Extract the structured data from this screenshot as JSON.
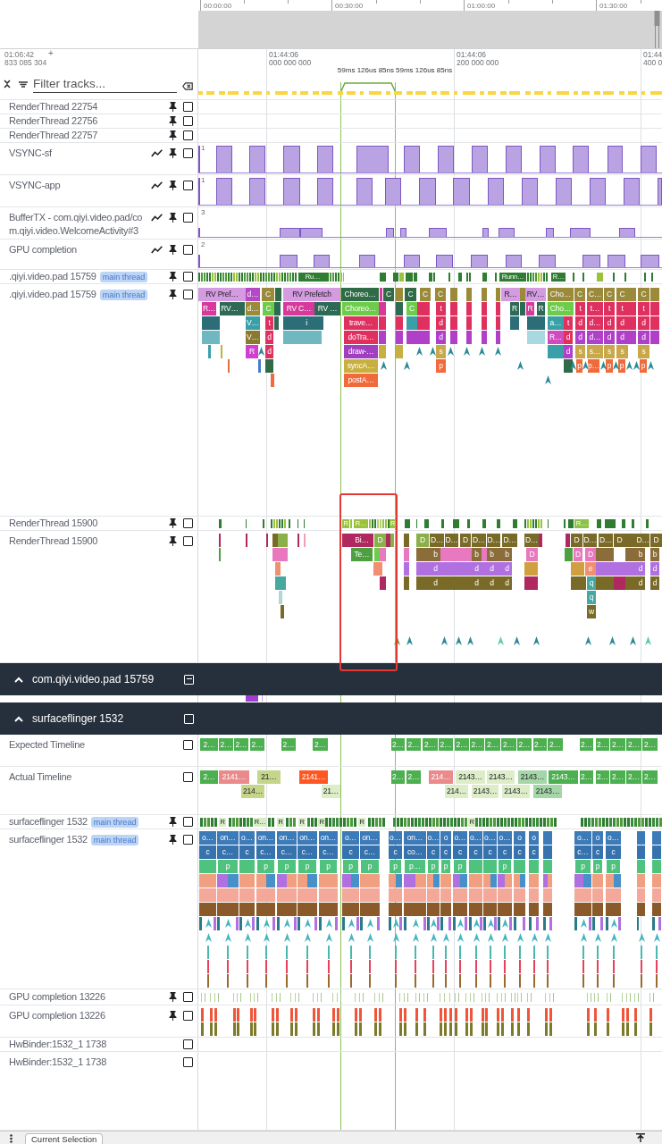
{
  "overview": {
    "ticks": [
      "00:00:00",
      "00:30:00",
      "01:00:00",
      "01:30:00"
    ]
  },
  "ruler": {
    "offset_time": "01:06:42",
    "offset_button": "+",
    "offset_ns": "833 085 304",
    "ticks": [
      {
        "time": "01:44:06",
        "ns": "000 000 000"
      },
      {
        "time": "01:44:06",
        "ns": "200 000 000"
      },
      {
        "time": "01:44",
        "ns": "400 0"
      }
    ],
    "selection_labels": [
      "59ms 126us 85ns",
      "59ms 126us 85ns"
    ]
  },
  "filter": {
    "placeholder": "Filter tracks..."
  },
  "tracks": [
    {
      "kind": "slice",
      "label": "RenderThread 22754",
      "pin_button": true,
      "checked": false
    },
    {
      "kind": "slice",
      "label": "RenderThread 22756",
      "pin_button": true,
      "checked": false
    },
    {
      "kind": "slice",
      "label": "RenderThread 22757",
      "pin_button": true,
      "checked": false
    },
    {
      "kind": "counter",
      "label": "VSYNC-sf",
      "max_label": "1",
      "chart_button": true,
      "pin_button": true,
      "checked": false
    },
    {
      "kind": "counter",
      "label": "VSYNC-app",
      "max_label": "1",
      "chart_button": true,
      "pin_button": true,
      "checked": false
    },
    {
      "kind": "counter",
      "label": "BufferTX - com.qiyi.video.pad/com.qiyi.video.WelcomeActivity#3",
      "max_label": "3",
      "chart_button": true,
      "pin_button": true,
      "checked": false
    },
    {
      "kind": "counter",
      "label": "GPU completion",
      "max_label": "2",
      "chart_button": true,
      "pin_button": true,
      "checked": false
    },
    {
      "kind": "state",
      "label": ".qiyi.video.pad 15759",
      "tag": "main thread",
      "pin_button": true,
      "checked": false,
      "slices": [
        {
          "label": "Ru…",
          "color": "#2f7d32"
        },
        {
          "label": "Runn…",
          "color": "#2f7d32"
        },
        {
          "label": "R…",
          "color": "#2f7d32"
        }
      ]
    },
    {
      "kind": "slice",
      "label": ".qiyi.video.pad 15759",
      "tag": "main thread",
      "pin_button": true,
      "checked": false,
      "slices": [
        {
          "label": "RV Pref…",
          "color": "#d49be0",
          "children": [
            {
              "label": "R…",
              "color": "#d6399b"
            },
            {
              "label": "RV…",
              "color": "#2d6a56"
            }
          ]
        },
        {
          "label": "d…",
          "color": "#b548c6",
          "children": [
            {
              "label": "d…",
              "color": "#9a8a3a",
              "children": [
                {
                  "label": "V…",
                  "color": "#3aa0a8",
                  "children": [
                    {
                      "label": "V…",
                      "color": "#8a7a30",
                      "children": [
                        {
                          "label": "R",
                          "color": "#d040d0"
                        }
                      ]
                    }
                  ]
                }
              ]
            }
          ]
        },
        {
          "label": "C",
          "color": "#9a8a3a",
          "children": [
            {
              "label": "C",
              "color": "#6dcc4a",
              "children": [
                {
                  "label": "t",
                  "color": "#e0305f",
                  "children": [
                    {
                      "label": "d",
                      "color": "#e0305f",
                      "children": [
                        {
                          "label": "d",
                          "color": "#e0305f"
                        }
                      ]
                    }
                  ]
                }
              ]
            }
          ]
        },
        {
          "label": "RV Prefetch",
          "color": "#d49be0",
          "children": [
            {
              "label": "RV C…",
              "color": "#d6399b",
              "children": [
                {
                  "label": "i",
                  "color": "#2c6e78"
                }
              ]
            },
            {
              "label": "RV …",
              "color": "#2d6a56"
            }
          ]
        },
        {
          "label": "Choreo…",
          "color": "#2e6b46",
          "children": [
            {
              "label": "Choreo…",
              "color": "#6dcc4a",
              "children": [
                {
                  "label": "trave…",
                  "color": "#e0305f",
                  "children": [
                    {
                      "label": "doTra…",
                      "color": "#e0305f",
                      "children": [
                        {
                          "label": "draw-…",
                          "color": "#a040c0",
                          "children": [
                            {
                              "label": "syncA…",
                              "color": "#c8b040",
                              "children": [
                                {
                                  "label": "postA…",
                                  "color": "#f06a3c"
                                }
                              ]
                            }
                          ]
                        }
                      ]
                    }
                  ]
                }
              ]
            }
          ]
        },
        {
          "label": "C",
          "color": "#2e6b46"
        },
        {
          "label": "C",
          "color": "#2e6b46",
          "children": [
            {
              "label": "C",
              "color": "#6dcc4a"
            }
          ]
        },
        {
          "label": "C",
          "color": "#9a8a3a"
        },
        {
          "label": "C",
          "color": "#9a8a3a",
          "children": [
            {
              "label": "t",
              "color": "#e0305f",
              "children": [
                {
                  "label": "d",
                  "color": "#e0305f",
                  "children": [
                    {
                      "label": "d",
                      "color": "#b040c8",
                      "children": [
                        {
                          "label": "s",
                          "color": "#c8a84a",
                          "children": [
                            {
                              "label": "p",
                              "color": "#f06a3c"
                            }
                          ]
                        }
                      ]
                    }
                  ]
                }
              ]
            }
          ]
        },
        {
          "label": "R…",
          "color": "#d49be0",
          "children": [
            {
              "label": "R",
              "color": "#2d6a56"
            }
          ]
        },
        {
          "label": "RV…",
          "color": "#d49be0",
          "children": [
            {
              "label": "R",
              "color": "#d6399b"
            },
            {
              "label": "R",
              "color": "#2d6a56"
            }
          ]
        },
        {
          "label": "Cho…",
          "color": "#9a8a3a",
          "children": [
            {
              "label": "Cho…",
              "color": "#6dcc4a",
              "children": [
                {
                  "label": "a…",
                  "color": "#3aa0a8",
                  "children": [
                    {
                      "label": "R…",
                      "color": "#d04ac0"
                    }
                  ]
                },
                {
                  "label": "t",
                  "color": "#e0305f",
                  "children": [
                    {
                      "label": "d",
                      "color": "#e0305f",
                      "children": [
                        {
                          "label": "d",
                          "color": "#b040c8"
                        }
                      ]
                    }
                  ]
                }
              ]
            }
          ]
        },
        {
          "label": "C",
          "color": "#9a8a3a",
          "children": [
            {
              "label": "t",
              "color": "#e0305f",
              "children": [
                {
                  "label": "d",
                  "color": "#e0305f",
                  "children": [
                    {
                      "label": "d",
                      "color": "#b040c8",
                      "children": [
                        {
                          "label": "s",
                          "color": "#c8a84a",
                          "children": [
                            {
                              "label": "p",
                              "color": "#f06a3c"
                            }
                          ]
                        }
                      ]
                    }
                  ]
                }
              ]
            }
          ]
        },
        {
          "label": "C…",
          "color": "#9a8a3a",
          "children": [
            {
              "label": "t…",
              "color": "#e0305f",
              "children": [
                {
                  "label": "d…",
                  "color": "#e0305f",
                  "children": [
                    {
                      "label": "d…",
                      "color": "#b040c8",
                      "children": [
                        {
                          "label": "s…",
                          "color": "#c8a84a",
                          "children": [
                            {
                              "label": "p…",
                              "color": "#f06a3c"
                            }
                          ]
                        }
                      ]
                    }
                  ]
                }
              ]
            }
          ]
        },
        {
          "label": "C",
          "color": "#9a8a3a",
          "children": [
            {
              "label": "t",
              "color": "#e0305f",
              "children": [
                {
                  "label": "d",
                  "color": "#e0305f",
                  "children": [
                    {
                      "label": "d",
                      "color": "#b040c8",
                      "children": [
                        {
                          "label": "s",
                          "color": "#c8a84a",
                          "children": [
                            {
                              "label": "p",
                              "color": "#f06a3c"
                            }
                          ]
                        }
                      ]
                    }
                  ]
                }
              ]
            }
          ]
        },
        {
          "label": "C",
          "color": "#9a8a3a",
          "children": [
            {
              "label": "t",
              "color": "#e0305f",
              "children": [
                {
                  "label": "d",
                  "color": "#e0305f",
                  "children": [
                    {
                      "label": "d",
                      "color": "#b040c8",
                      "children": [
                        {
                          "label": "s",
                          "color": "#c8a84a",
                          "children": [
                            {
                              "label": "p",
                              "color": "#f06a3c"
                            }
                          ]
                        }
                      ]
                    }
                  ]
                }
              ]
            }
          ]
        },
        {
          "label": "C",
          "color": "#9a8a3a",
          "children": [
            {
              "label": "t",
              "color": "#e0305f",
              "children": [
                {
                  "label": "d",
                  "color": "#e0305f",
                  "children": [
                    {
                      "label": "d",
                      "color": "#b040c8",
                      "children": [
                        {
                          "label": "s",
                          "color": "#c8a84a",
                          "children": [
                            {
                              "label": "p",
                              "color": "#f06a3c"
                            }
                          ]
                        }
                      ]
                    }
                  ]
                }
              ]
            }
          ]
        }
      ]
    },
    {
      "kind": "state",
      "label": "RenderThread 15900",
      "pin_button": true,
      "checked": false,
      "slices": [
        {
          "label": "R",
          "color": "#9ac23c"
        },
        {
          "label": "R…",
          "color": "#9ac23c"
        },
        {
          "label": "R",
          "color": "#9ac23c"
        },
        {
          "label": "R…",
          "color": "#8bc34a"
        }
      ]
    },
    {
      "kind": "slice",
      "label": "RenderThread 15900",
      "pin_button": true,
      "checked": false,
      "slices": [
        {
          "label": "Bi…",
          "color": "#b02860",
          "children": [
            {
              "label": "Te…",
              "color": "#4ca040"
            }
          ]
        },
        {
          "label": "D",
          "color": "#8ab04a"
        },
        {
          "label": "D",
          "color": "#8ab04a"
        },
        {
          "label": "D…",
          "color": "#7a6a28",
          "children": [
            {
              "label": "b",
              "color": "#8b6d3a",
              "children": [
                {
                  "label": "d",
                  "color": "#b070e0",
                  "children": [
                    {
                      "label": "d",
                      "color": "#7a6a28"
                    }
                  ]
                }
              ]
            }
          ]
        },
        {
          "label": "D…",
          "color": "#7a6a28"
        },
        {
          "label": "D",
          "color": "#7a6a28"
        },
        {
          "label": "D…",
          "color": "#7a6a28",
          "children": [
            {
              "label": "b",
              "color": "#8b6d3a",
              "children": [
                {
                  "label": "d",
                  "color": "#b070e0",
                  "children": [
                    {
                      "label": "d",
                      "color": "#7a6a28"
                    }
                  ]
                }
              ]
            }
          ]
        },
        {
          "label": "D…",
          "color": "#7a6a28",
          "children": [
            {
              "label": "b",
              "color": "#8b6d3a",
              "children": [
                {
                  "label": "d",
                  "color": "#b070e0",
                  "children": [
                    {
                      "label": "d",
                      "color": "#7a6a28"
                    }
                  ]
                }
              ]
            }
          ]
        },
        {
          "label": "D…",
          "color": "#7a6a28",
          "children": [
            {
              "label": "b",
              "color": "#8b6d3a",
              "children": [
                {
                  "label": "d",
                  "color": "#b070e0",
                  "children": [
                    {
                      "label": "d",
                      "color": "#7a6a28"
                    }
                  ]
                }
              ]
            }
          ]
        },
        {
          "label": "D…",
          "color": "#7a6a28",
          "children": [
            {
              "label": "D",
              "color": "#e878c0"
            }
          ]
        },
        {
          "label": "D",
          "color": "#7a6a28",
          "children": [
            {
              "label": "D",
              "color": "#e878c0"
            }
          ]
        },
        {
          "label": "D…",
          "color": "#7a6a28",
          "children": [
            {
              "label": "D",
              "color": "#e878c0",
              "children": [
                {
                  "label": "e",
                  "color": "#f09070",
                  "children": [
                    {
                      "label": "q",
                      "color": "#48a8a0",
                      "children": [
                        {
                          "label": "q",
                          "color": "#48a8a0",
                          "children": [
                            {
                              "label": "w",
                              "color": "#7a6a28"
                            }
                          ]
                        }
                      ]
                    }
                  ]
                }
              ]
            }
          ]
        },
        {
          "label": "D…",
          "color": "#7a6a28"
        },
        {
          "label": "D",
          "color": "#7a6a28"
        },
        {
          "label": "D…",
          "color": "#7a6a28",
          "children": [
            {
              "label": "b",
              "color": "#8b6d3a",
              "children": [
                {
                  "label": "d",
                  "color": "#b070e0",
                  "children": [
                    {
                      "label": "d",
                      "color": "#7a6a28"
                    }
                  ]
                }
              ]
            }
          ]
        },
        {
          "label": "D",
          "color": "#7a6a28",
          "children": [
            {
              "label": "b",
              "color": "#8b6d3a",
              "children": [
                {
                  "label": "d",
                  "color": "#b070e0",
                  "children": [
                    {
                      "label": "d",
                      "color": "#7a6a28"
                    }
                  ]
                }
              ]
            }
          ]
        }
      ]
    },
    {
      "kind": "group",
      "label": "com.qiyi.video.pad 15759",
      "expanded": true,
      "indeterminate": true
    },
    {
      "kind": "group",
      "label": "surfaceflinger 1532",
      "expanded": true,
      "checked": false
    },
    {
      "kind": "timeline",
      "label": "Expected Timeline",
      "checked": false,
      "slices": [
        {
          "label": "2…",
          "color": "#4caf50"
        },
        {
          "label": "2…",
          "color": "#4caf50"
        },
        {
          "label": "2…",
          "color": "#4caf50"
        },
        {
          "label": "2…",
          "color": "#4caf50"
        },
        {
          "label": "2…",
          "color": "#4caf50"
        },
        {
          "label": "2…",
          "color": "#4caf50"
        },
        {
          "label": "2…",
          "color": "#4caf50"
        },
        {
          "label": "2…",
          "color": "#4caf50"
        },
        {
          "label": "2…",
          "color": "#4caf50"
        },
        {
          "label": "2…",
          "color": "#4caf50"
        },
        {
          "label": "2…",
          "color": "#4caf50"
        },
        {
          "label": "2…",
          "color": "#4caf50"
        },
        {
          "label": "2…",
          "color": "#4caf50"
        },
        {
          "label": "2…",
          "color": "#4caf50"
        },
        {
          "label": "2…",
          "color": "#4caf50"
        },
        {
          "label": "2…",
          "color": "#4caf50"
        },
        {
          "label": "2…",
          "color": "#4caf50"
        },
        {
          "label": "2…",
          "color": "#4caf50"
        },
        {
          "label": "2…",
          "color": "#4caf50"
        },
        {
          "label": "2…",
          "color": "#4caf50"
        },
        {
          "label": "2…",
          "color": "#4caf50"
        },
        {
          "label": "2…",
          "color": "#4caf50"
        }
      ]
    },
    {
      "kind": "timeline",
      "label": "Actual Timeline",
      "checked": false,
      "slices": [
        {
          "label": "2…",
          "color": "#4caf50"
        },
        {
          "label": "2141…",
          "color": "#ea8a8a"
        },
        {
          "label": "214…",
          "color": "#c5d68a"
        },
        {
          "label": "21…",
          "color": "#c5d68a"
        },
        {
          "label": "2141…",
          "color": "#ff5722"
        },
        {
          "label": "21…",
          "color": "#dcedc8"
        },
        {
          "label": "2…",
          "color": "#4caf50"
        },
        {
          "label": "2…",
          "color": "#4caf50"
        },
        {
          "label": "214…",
          "color": "#ea8a8a"
        },
        {
          "label": "214…",
          "color": "#dcedc8"
        },
        {
          "label": "2143…",
          "color": "#dcedc8"
        },
        {
          "label": "2143…",
          "color": "#dcedc8"
        },
        {
          "label": "2143…",
          "color": "#dcedc8"
        },
        {
          "label": "2143…",
          "color": "#dcedc8"
        },
        {
          "label": "2143…",
          "color": "#a5d6a7"
        },
        {
          "label": "2143…",
          "color": "#a5d6a7"
        },
        {
          "label": "2143…",
          "color": "#4caf50"
        },
        {
          "label": "2…",
          "color": "#4caf50"
        },
        {
          "label": "2…",
          "color": "#4caf50"
        },
        {
          "label": "2…",
          "color": "#4caf50"
        },
        {
          "label": "2…",
          "color": "#4caf50"
        },
        {
          "label": "2…",
          "color": "#4caf50"
        }
      ]
    },
    {
      "kind": "state",
      "label": "surfaceflinger 1532",
      "tag": "main thread",
      "pin_button": true,
      "checked": false,
      "slices": [
        {
          "label": "R",
          "color": "#d7ecc4"
        },
        {
          "label": "R…",
          "color": "#d7ecc4"
        },
        {
          "label": "R",
          "color": "#d7ecc4"
        },
        {
          "label": "R",
          "color": "#d7ecc4"
        },
        {
          "label": "R",
          "color": "#d7ecc4"
        },
        {
          "label": "R",
          "color": "#d7ecc4"
        },
        {
          "label": "R",
          "color": "#d7ecc4"
        }
      ]
    },
    {
      "kind": "slice",
      "label": "surfaceflinger 1532",
      "tag": "main thread",
      "pin_button": true,
      "checked": false,
      "slices": [
        {
          "label": "o…",
          "color": "#3d7ab8",
          "children": [
            {
              "label": "c",
              "color": "#3672ad"
            }
          ]
        },
        {
          "label": "on…",
          "color": "#3d7ab8",
          "children": [
            {
              "label": "c…",
              "color": "#3672ad",
              "children": [
                {
                  "label": "p",
                  "color": "#4fc37e"
                }
              ]
            }
          ]
        },
        {
          "label": "o…",
          "color": "#3d7ab8",
          "children": [
            {
              "label": "c",
              "color": "#3672ad"
            }
          ]
        },
        {
          "label": "on…",
          "color": "#3d7ab8",
          "children": [
            {
              "label": "c…",
              "color": "#3672ad",
              "children": [
                {
                  "label": "p",
                  "color": "#4fc37e"
                }
              ]
            }
          ]
        },
        {
          "label": "on…",
          "color": "#3d7ab8",
          "children": [
            {
              "label": "c…",
              "color": "#3672ad",
              "children": [
                {
                  "label": "p",
                  "color": "#4fc37e"
                }
              ]
            }
          ]
        },
        {
          "label": "on…",
          "color": "#3d7ab8",
          "children": [
            {
              "label": "c…",
              "color": "#3672ad",
              "children": [
                {
                  "label": "p",
                  "color": "#4fc37e"
                }
              ]
            }
          ]
        },
        {
          "label": "on…",
          "color": "#3d7ab8",
          "children": [
            {
              "label": "c…",
              "color": "#3672ad",
              "children": [
                {
                  "label": "p",
                  "color": "#4fc37e"
                }
              ]
            }
          ]
        },
        {
          "label": "o…",
          "color": "#3d7ab8",
          "children": [
            {
              "label": "c",
              "color": "#3672ad",
              "children": [
                {
                  "label": "p",
                  "color": "#4fc37e"
                }
              ]
            }
          ]
        },
        {
          "label": "on…",
          "color": "#3d7ab8",
          "children": [
            {
              "label": "c…",
              "color": "#3672ad",
              "children": [
                {
                  "label": "p",
                  "color": "#4fc37e"
                }
              ]
            }
          ]
        },
        {
          "label": "o…",
          "color": "#3d7ab8",
          "children": [
            {
              "label": "c",
              "color": "#3672ad",
              "children": [
                {
                  "label": "p",
                  "color": "#4fc37e"
                }
              ]
            }
          ]
        },
        {
          "label": "on…",
          "color": "#3d7ab8",
          "children": [
            {
              "label": "co…",
              "color": "#3672ad",
              "children": [
                {
                  "label": "p…",
                  "color": "#4fc37e"
                }
              ]
            }
          ]
        },
        {
          "label": "o…",
          "color": "#3d7ab8",
          "children": [
            {
              "label": "c",
              "color": "#3672ad",
              "children": [
                {
                  "label": "p",
                  "color": "#4fc37e"
                }
              ]
            }
          ]
        },
        {
          "label": "o",
          "color": "#3d7ab8",
          "children": [
            {
              "label": "c",
              "color": "#3672ad",
              "children": [
                {
                  "label": "p",
                  "color": "#4fc37e"
                }
              ]
            }
          ]
        },
        {
          "label": "o…",
          "color": "#3d7ab8",
          "children": [
            {
              "label": "c",
              "color": "#3672ad",
              "children": [
                {
                  "label": "p",
                  "color": "#4fc37e"
                }
              ]
            }
          ]
        },
        {
          "label": "o…",
          "color": "#3d7ab8",
          "children": [
            {
              "label": "c",
              "color": "#3672ad"
            }
          ]
        },
        {
          "label": "o…",
          "color": "#3d7ab8",
          "children": [
            {
              "label": "c",
              "color": "#3672ad"
            }
          ]
        },
        {
          "label": "o…",
          "color": "#3d7ab8",
          "children": [
            {
              "label": "c",
              "color": "#3672ad",
              "children": [
                {
                  "label": "p",
                  "color": "#4fc37e"
                }
              ]
            }
          ]
        },
        {
          "label": "o",
          "color": "#3d7ab8",
          "children": [
            {
              "label": "c",
              "color": "#3672ad"
            }
          ]
        },
        {
          "label": "o",
          "color": "#3d7ab8",
          "children": [
            {
              "label": "c",
              "color": "#3672ad"
            }
          ]
        },
        {
          "label": "o…",
          "color": "#3d7ab8",
          "children": [
            {
              "label": "c…",
              "color": "#3672ad",
              "children": [
                {
                  "label": "p",
                  "color": "#4fc37e"
                }
              ]
            }
          ]
        },
        {
          "label": "o",
          "color": "#3d7ab8",
          "children": [
            {
              "label": "c",
              "color": "#3672ad",
              "children": [
                {
                  "label": "p",
                  "color": "#4fc37e"
                }
              ]
            }
          ]
        },
        {
          "label": "o…",
          "color": "#3d7ab8",
          "children": [
            {
              "label": "c",
              "color": "#3672ad",
              "children": [
                {
                  "label": "p",
                  "color": "#4fc37e"
                }
              ]
            }
          ]
        }
      ]
    },
    {
      "kind": "state",
      "label": "GPU completion 13226",
      "pin_button": true,
      "checked": false
    },
    {
      "kind": "slice",
      "label": "GPU completion 13226",
      "pin_button": true,
      "checked": false
    },
    {
      "kind": "slice",
      "label": "HwBinder:1532_1 1738",
      "checked": false
    },
    {
      "kind": "slice",
      "label": "HwBinder:1532_1 1738",
      "checked": false
    }
  ],
  "bottom_bar": {
    "tabs": [
      {
        "label": "Current Selection",
        "selected": true
      }
    ]
  }
}
